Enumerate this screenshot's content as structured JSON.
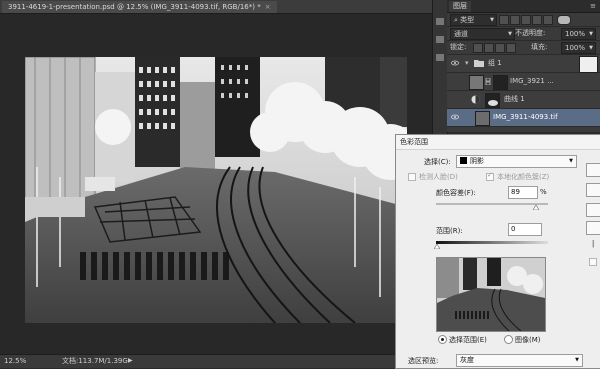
{
  "document": {
    "tab_title": "3911-4619-1-presentation.psd @ 12.5% (IMG_3911-4093.tif, RGB/16*) *",
    "tab_close": "×"
  },
  "status": {
    "zoom": "12.5%",
    "doc_size": "文档:113.7M/1.39G",
    "arrow": "▶"
  },
  "layers_panel": {
    "title": "图层",
    "menu_icon": "≡",
    "filter_kind": "类型",
    "blend_mode": "通道",
    "opacity_label": "不透明度:",
    "opacity_value": "100%",
    "lock_label": "锁定:",
    "fill_label": "填充:",
    "fill_value": "100%",
    "layers": [
      {
        "name": "组 1",
        "type": "group",
        "visible": true,
        "selected": false
      },
      {
        "name": "IMG_3921 ...",
        "type": "image",
        "visible": false,
        "selected": false
      },
      {
        "name": "曲线 1",
        "type": "adjustment",
        "visible": false,
        "selected": false
      },
      {
        "name": "IMG_3911-4093.tif",
        "type": "image",
        "visible": true,
        "selected": true
      }
    ]
  },
  "dialog": {
    "title": "色彩范围",
    "select_label": "选择(C):",
    "select_value": "阴影",
    "detect_faces": "检测人脸(D)",
    "localized": "本地化颜色簇(Z)",
    "fuzziness_label": "颜色容差(F):",
    "fuzziness_value": "89",
    "fuzziness_unit": "%",
    "fuzziness_level": 0.89,
    "range_label": "范围(R):",
    "range_value": "0",
    "radio_selection": "选择范围(E)",
    "radio_image": "图像(M)",
    "preview_label": "选区预览:",
    "preview_value": "灰度"
  },
  "colors": {
    "selected_layer": "#5a6c86",
    "panel_bg": "#3a3a3a",
    "dialog_bg": "#eeeeee"
  }
}
